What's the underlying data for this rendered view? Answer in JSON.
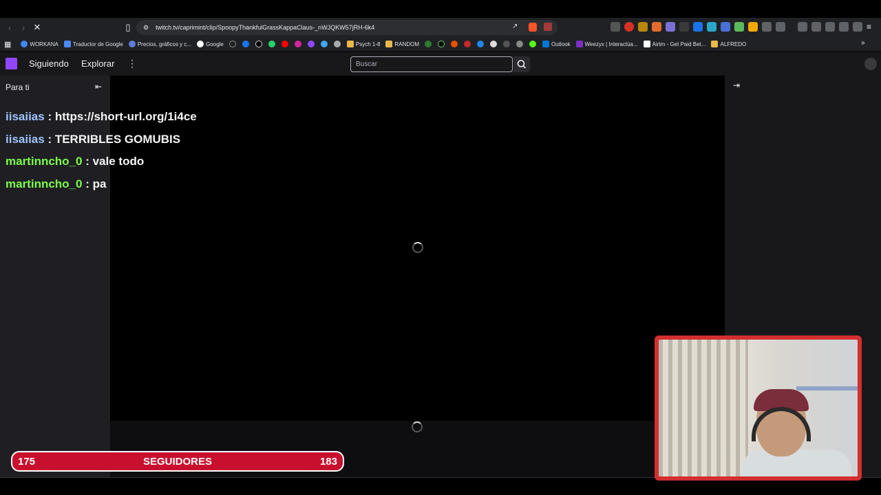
{
  "browser": {
    "url": "twitch.tv/caprimint/clip/SpoopyThankfulGrassKappaClaus-_nWJQKW57jRH-6k4",
    "bookmarks": [
      "WORKANA",
      "Traductor de Google",
      "Precios, gráficos y c...",
      "Google",
      "Psych 1-8",
      "RANDOM",
      "Outlook",
      "Weezyx | Interactúa...",
      "Airtm - Get Paid Bet...",
      "ALFREDO"
    ]
  },
  "twitch": {
    "nav": {
      "following": "Siguiendo",
      "browse": "Explorar",
      "search_placeholder": "Buscar"
    },
    "sidebar": {
      "title": "Para ti"
    },
    "chat": [
      {
        "user": "iisaiias",
        "sep": " : ",
        "text": "https://short-url.org/1i4ce"
      },
      {
        "user": "iisaiias",
        "sep": " : ",
        "text": "TERRIBLES GOMUBIS"
      },
      {
        "user": "martinncho_0",
        "sep": " : ",
        "text": "vale todo"
      },
      {
        "user": "martinncho_0",
        "sep": " : ",
        "text": "pa"
      }
    ]
  },
  "overlay": {
    "followers_current": "175",
    "followers_label": "SEGUIDORES",
    "followers_goal": "183"
  },
  "colors": {
    "twitch_purple": "#9147ff",
    "overlay_red": "#c8102e",
    "chat_user_blue": "#a0c4ff",
    "chat_user_green": "#7cff4a"
  }
}
